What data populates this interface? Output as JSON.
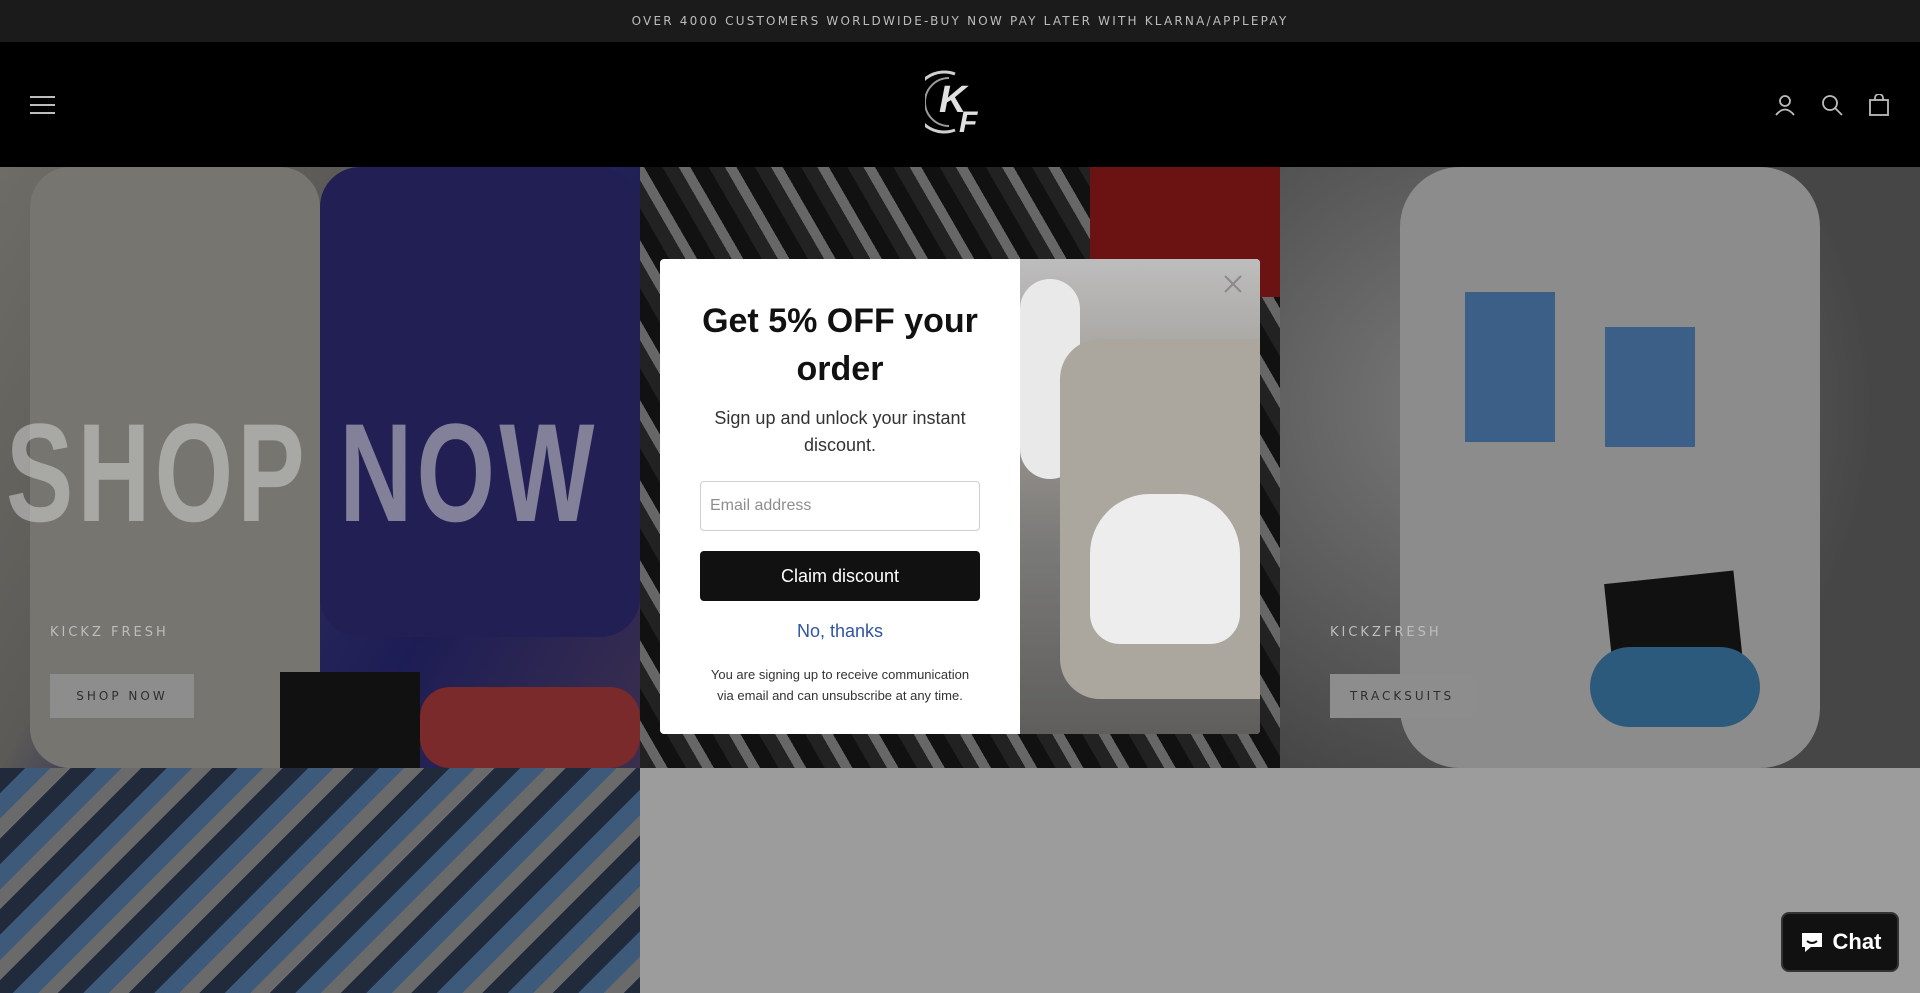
{
  "announcement": "OVER 4000 CUSTOMERS WORLDWIDE-BUY NOW PAY LATER WITH KLARNA/APPLEPAY",
  "header": {
    "logo_text": "KF",
    "icons": [
      "menu-icon",
      "account-icon",
      "search-icon",
      "cart-icon"
    ]
  },
  "tiles": [
    {
      "overlay_text": "SHOP NOW",
      "caption": "KICKZ FRESH",
      "button": "SHOP NOW"
    },
    {
      "caption": "",
      "button": ""
    },
    {
      "caption": "KICKZFRESH",
      "button": "TRACKSUITS"
    }
  ],
  "modal": {
    "title": "Get 5% OFF your order",
    "subtitle": "Sign up and unlock your instant discount.",
    "email_placeholder": "Email address",
    "claim_button": "Claim discount",
    "decline_link": "No, thanks",
    "disclaimer": "You are signing up to receive communication via email and can unsubscribe at any time."
  },
  "chat": {
    "label": "Chat",
    "icon": "chat-bubble-icon"
  },
  "colors": {
    "announcement_bg": "#1b1b1b",
    "header_bg": "#000000",
    "modal_button": "#111111",
    "link": "#2f54a3"
  }
}
